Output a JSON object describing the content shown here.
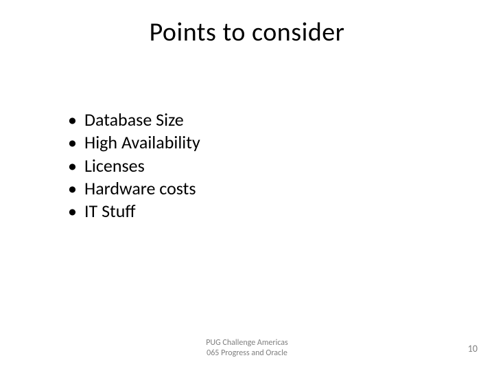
{
  "title": "Points to consider",
  "bullets": [
    "Database Size",
    "High Availability",
    "Licenses",
    "Hardware costs",
    "IT Stuff"
  ],
  "footer": {
    "line1": "PUG Challenge Americas",
    "line2": "065 Progress and Oracle"
  },
  "page_number": "10"
}
